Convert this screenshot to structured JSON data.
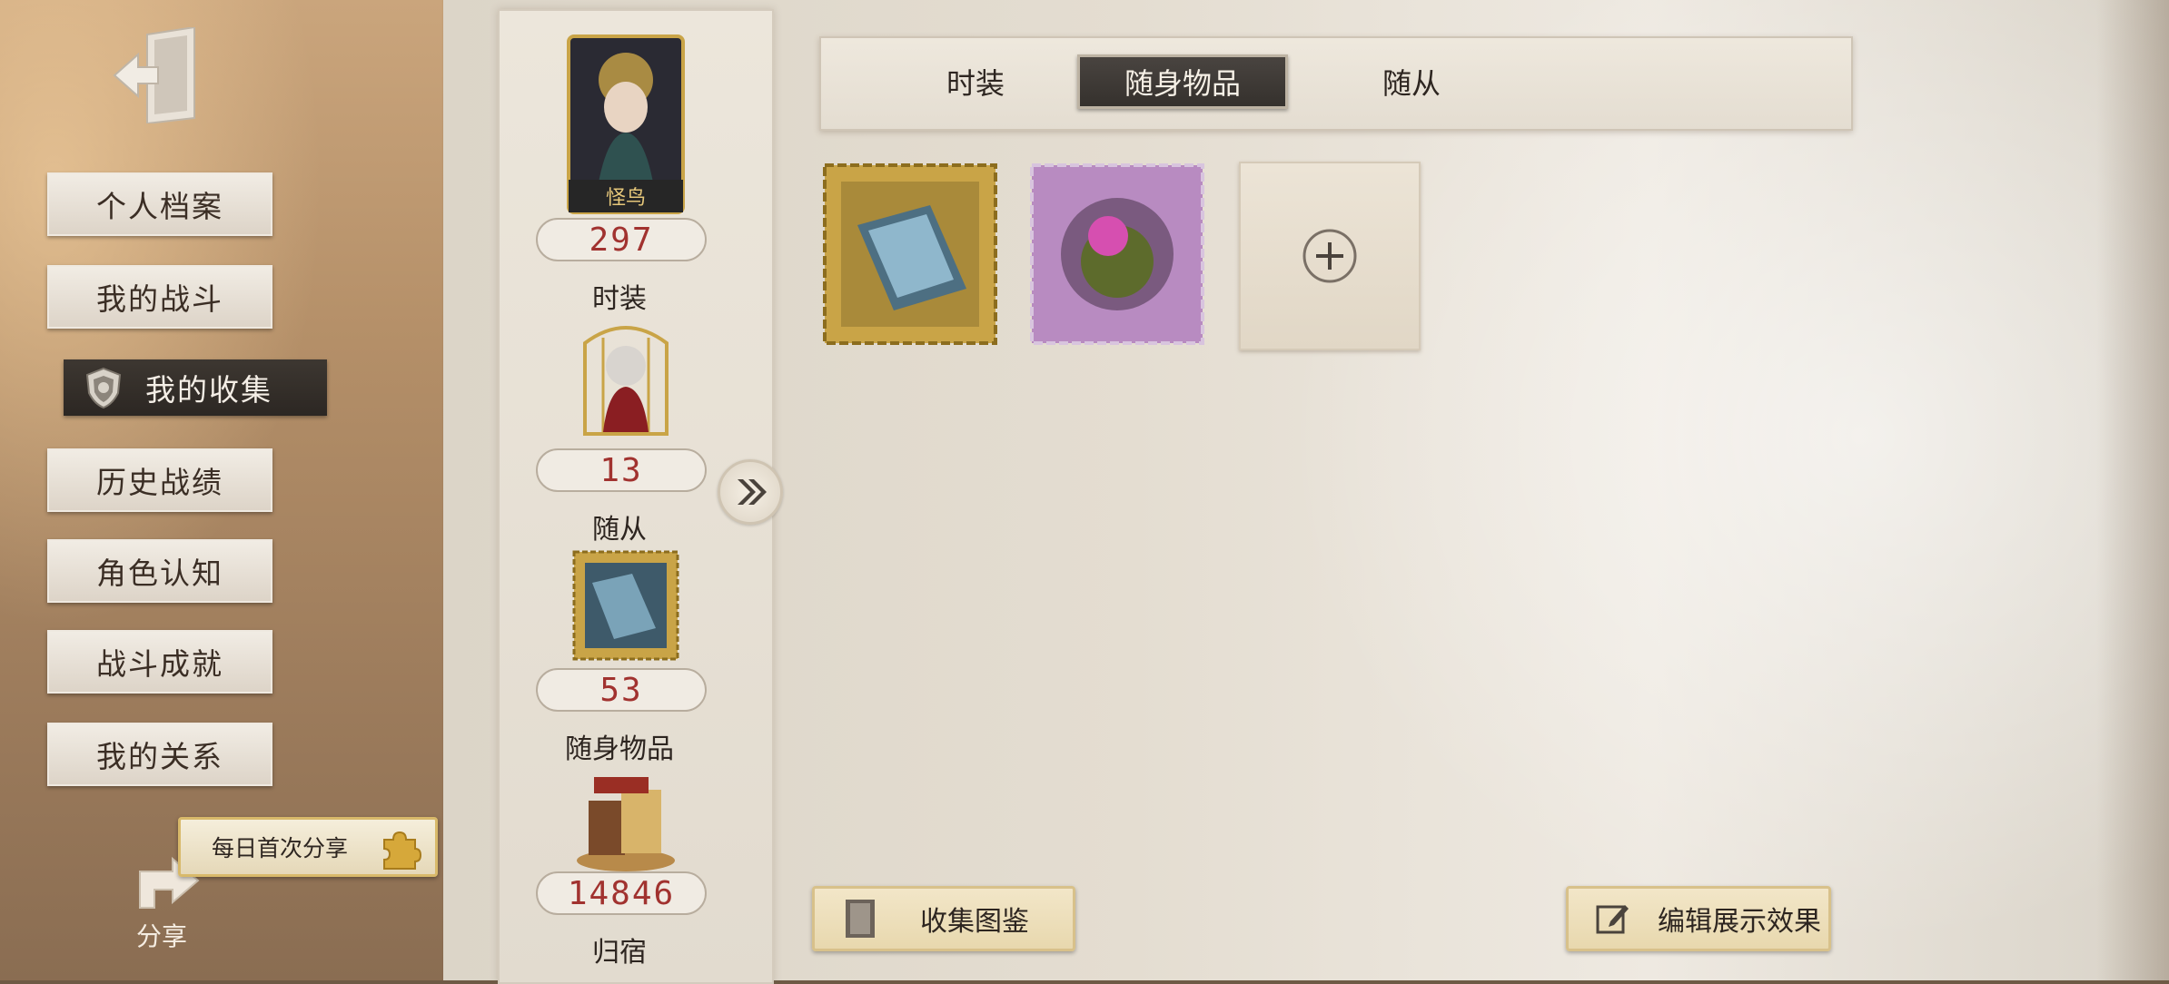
{
  "nav": {
    "exit_icon": "exit-door-icon",
    "items": [
      {
        "label": "个人档案"
      },
      {
        "label": "我的战斗"
      },
      {
        "label": "我的收集",
        "active": true,
        "icon": "shield-icon"
      },
      {
        "label": "历史战绩"
      },
      {
        "label": "角色认知"
      },
      {
        "label": "战斗成就"
      },
      {
        "label": "我的关系"
      }
    ],
    "share_toast": "每日首次分享",
    "share_label": "分享"
  },
  "stats": [
    {
      "value": "297",
      "label": "时装",
      "image_caption": "怪鸟"
    },
    {
      "value": "13",
      "label": "随从"
    },
    {
      "value": "53",
      "label": "随身物品"
    },
    {
      "value": "14846",
      "label": "归宿"
    }
  ],
  "tabs": [
    {
      "label": "时装"
    },
    {
      "label": "随身物品",
      "active": true
    },
    {
      "label": "随从"
    }
  ],
  "items": [
    {
      "name": "golden-stamp-book-item"
    },
    {
      "name": "purple-stamp-flower-item"
    },
    {
      "name": "empty-add-slot",
      "icon": "plus-icon"
    }
  ],
  "buttons": {
    "collection_guide": "收集图鉴",
    "edit_display": "编辑展示效果"
  },
  "colors": {
    "stat_value": "#a1322f",
    "active_tab_bg": "#35312d",
    "gold_border": "#d8c18a"
  }
}
